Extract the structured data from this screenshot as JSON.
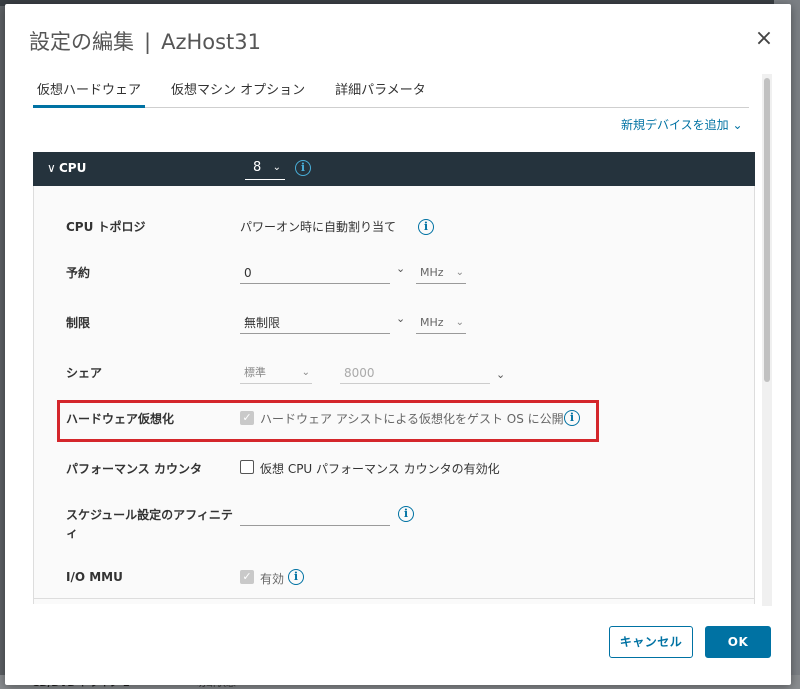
{
  "dialog": {
    "title": "設定の編集",
    "separator": "|",
    "vm_name": "AzHost31",
    "close_label": "×"
  },
  "tabs": [
    {
      "label": "仮想ハードウェア",
      "active": true
    },
    {
      "label": "仮想マシン オプション",
      "active": false
    },
    {
      "label": "詳細パラメータ",
      "active": false
    }
  ],
  "add_device": {
    "label": "新規デバイスを追加 ⌄"
  },
  "cpu": {
    "title": "CPU",
    "count": "8",
    "topology": {
      "label": "CPU トポロジ",
      "value": "パワーオン時に自動割り当て"
    },
    "reservation": {
      "label": "予約",
      "value": "0",
      "unit": "MHz"
    },
    "limit": {
      "label": "制限",
      "value": "無制限",
      "unit": "MHz"
    },
    "shares": {
      "label": "シェア",
      "level": "標準",
      "value": "8000"
    },
    "hw_virt": {
      "label": "ハードウェア仮想化",
      "option": "ハードウェア アシストによる仮想化をゲスト OS に公開",
      "checked": true
    },
    "perf_counter": {
      "label": "パフォーマンス カウンタ",
      "option": "仮想 CPU パフォーマンス カウンタの有効化",
      "checked": false
    },
    "sched_affinity": {
      "label": "スケジュール設定のアフィニティ",
      "value": ""
    },
    "iommu": {
      "label": "I/O MMU",
      "option": "有効",
      "checked": true
    }
  },
  "footer": {
    "cancel_label": "キャンセル",
    "ok_label": "OK"
  },
  "background": {
    "bottom_text": "CD/DVD ドライブ 1",
    "bottom_text2": "切断状態"
  },
  "icons": {
    "info": "i",
    "check": "✓",
    "chevron_down": "⌄",
    "caret_down": "∨"
  },
  "colors": {
    "accent": "#0072a3",
    "header_bg": "#25333d",
    "highlight": "#d4262b"
  }
}
